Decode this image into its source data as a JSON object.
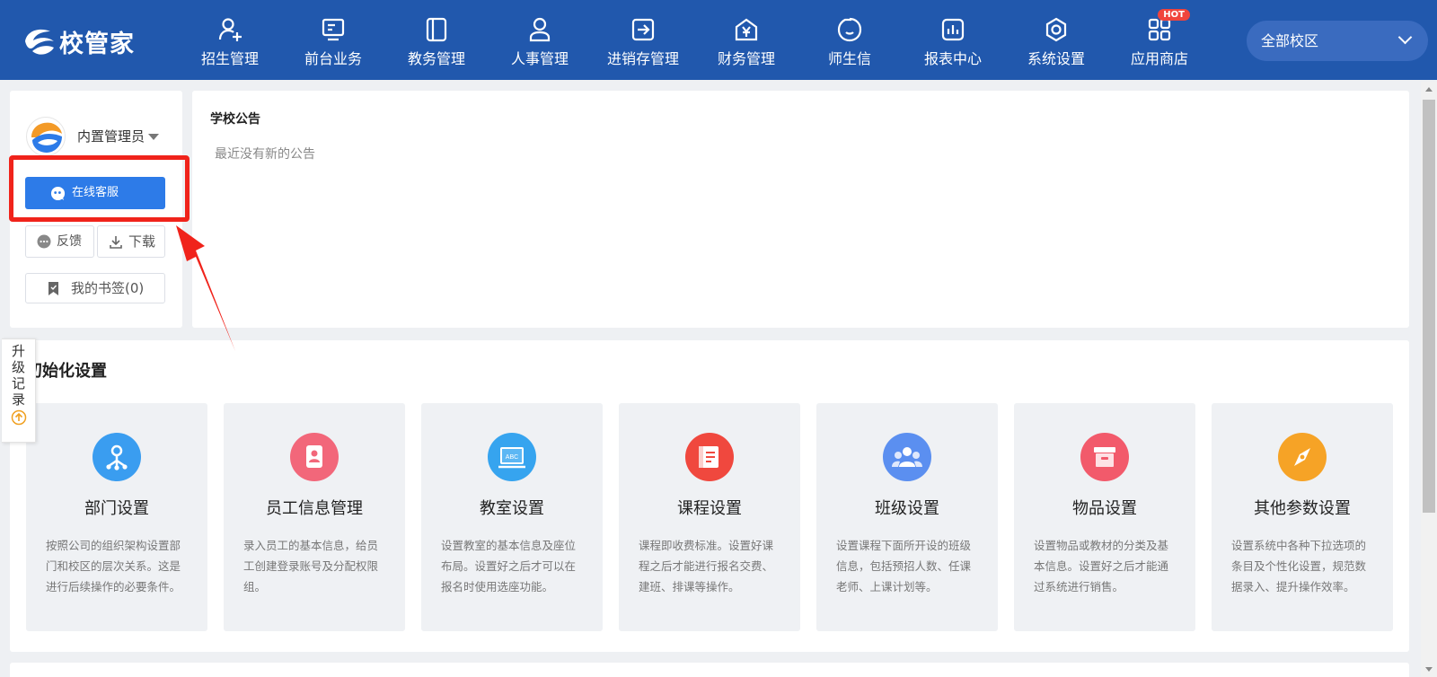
{
  "brand": {
    "name": "校管家"
  },
  "nav": {
    "items": [
      {
        "label": "招生管理",
        "icon": "user-plus-icon"
      },
      {
        "label": "前台业务",
        "icon": "monitor-icon"
      },
      {
        "label": "教务管理",
        "icon": "book-icon"
      },
      {
        "label": "人事管理",
        "icon": "person-icon"
      },
      {
        "label": "进销存管理",
        "icon": "arrow-box-icon"
      },
      {
        "label": "财务管理",
        "icon": "yen-house-icon"
      },
      {
        "label": "师生信",
        "icon": "chat-bubble-icon"
      },
      {
        "label": "报表中心",
        "icon": "report-chart-icon"
      },
      {
        "label": "系统设置",
        "icon": "hexagon-gear-icon"
      },
      {
        "label": "应用商店",
        "icon": "app-grid-icon",
        "badge": "HOT"
      }
    ],
    "campus": "全部校区"
  },
  "user": {
    "name": "内置管理员",
    "support_label": "在线客服",
    "feedback_label": "反馈",
    "download_label": "下载",
    "bookmark_label": "我的书签(0)"
  },
  "notice": {
    "title": "学校公告",
    "empty": "最近没有新的公告"
  },
  "init": {
    "title": "初始化设置",
    "cards": [
      {
        "title": "部门设置",
        "desc": "按照公司的组织架构设置部门和校区的层次关系。这是进行后续操作的必要条件。",
        "icon": "org-chart-icon",
        "color": "#3a9df0"
      },
      {
        "title": "员工信息管理",
        "desc": "录入员工的基本信息，给员工创建登录账号及分配权限组。",
        "icon": "id-card-icon",
        "color": "#f2677a"
      },
      {
        "title": "教室设置",
        "desc": "设置教室的基本信息及座位布局。设置好之后才可以在报名时使用选座功能。",
        "icon": "blackboard-icon",
        "color": "#36a4ef"
      },
      {
        "title": "课程设置",
        "desc": "课程即收费标准。设置好课程之后才能进行报名交费、建班、排课等操作。",
        "icon": "course-book-icon",
        "color": "#f0483e"
      },
      {
        "title": "班级设置",
        "desc": "设置课程下面所开设的班级信息，包括预招人数、任课老师、上课计划等。",
        "icon": "group-icon",
        "color": "#5b8ff0"
      },
      {
        "title": "物品设置",
        "desc": "设置物品或教材的分类及基本信息。设置好之后才能通过系统进行销售。",
        "icon": "box-icon",
        "color": "#f25a6b"
      },
      {
        "title": "其他参数设置",
        "desc": "设置系统中各种下拉选项的条目及个性化设置，规范数据录入、提升操作效率。",
        "icon": "compass-icon",
        "color": "#f6a326"
      }
    ]
  },
  "upgrade": {
    "label": "升级记录"
  }
}
